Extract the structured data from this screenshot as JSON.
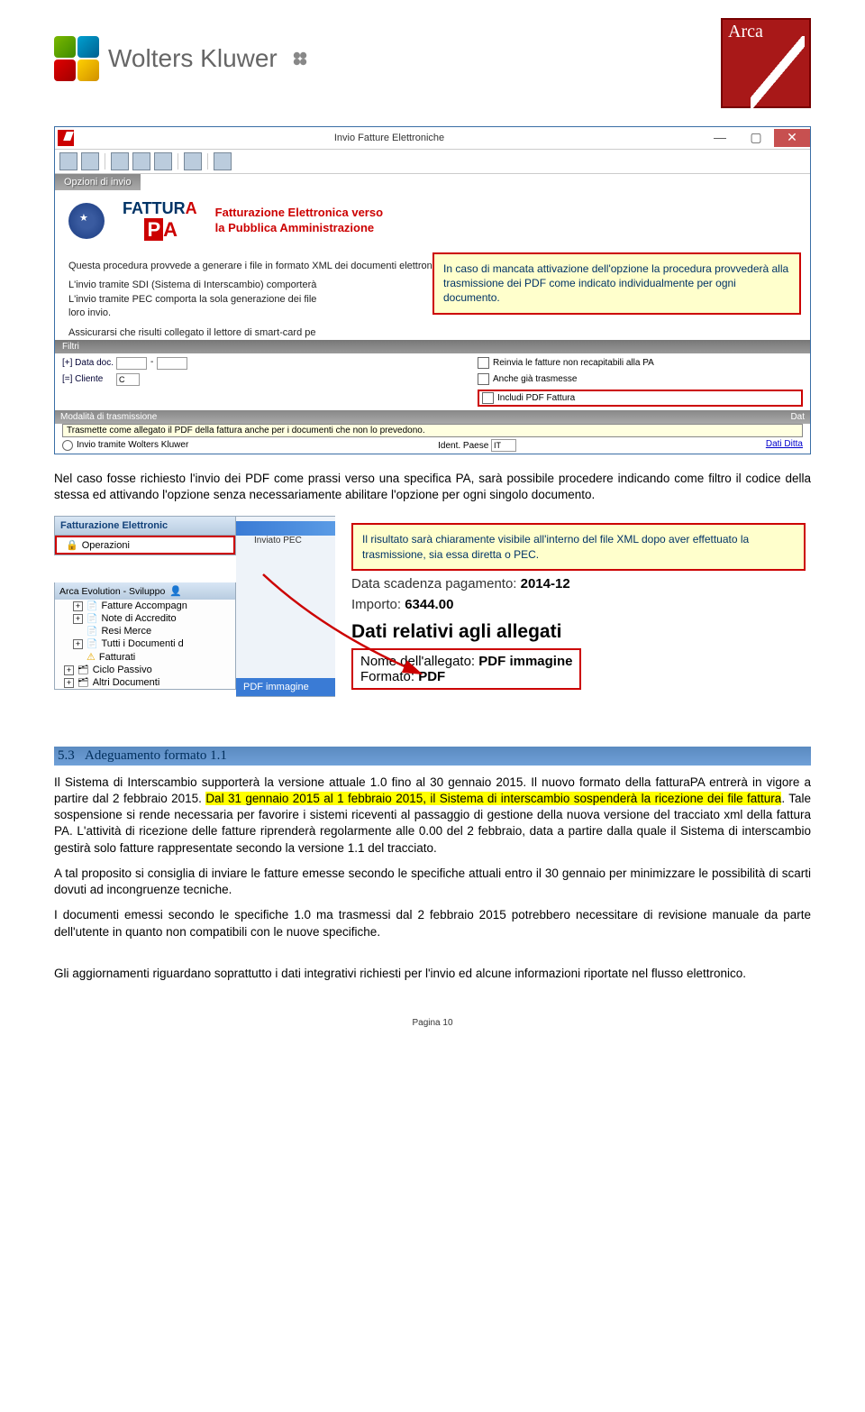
{
  "logos": {
    "wolters_kluwer": "Wolters Kluwer",
    "arca": "Arca"
  },
  "window1": {
    "title": "Invio Fatture Elettroniche",
    "tab": "Opzioni di invio",
    "heading1": "FATTUR",
    "heading_title_line1": "Fatturazione Elettronica verso",
    "heading_title_line2": "la Pubblica Amministrazione",
    "proc_line1": "Questa procedura provvede a generare i file in formato XML dei documenti elettronici.",
    "proc_line2": "L'invio tramite SDI (Sistema di Interscambio) comporterà",
    "proc_line3": "L'invio tramite PEC comporta la sola generazione dei file",
    "proc_line4": "loro invio.",
    "proc_line5": "Assicurarsi che risulti collegato il lettore di smart-card pe",
    "filter_tab": "Filtri",
    "filter_date_lbl": "[+] Data doc.",
    "filter_cli_lbl": "[=] Cliente",
    "filter_cli_val": "C",
    "chk1": "Reinvia le fatture non recapitabili alla PA",
    "chk2": "Anche già trasmesse",
    "chk3": "Includi PDF Fattura",
    "modal_lbl": "Modalità di trasmissione",
    "tooltip": "Trasmette come allegato il PDF della fattura anche per i documenti che non lo prevedono.",
    "ident_lbl": "Ident. Paese",
    "ident_val": "IT",
    "bottom_right": "Dati Ditta",
    "radio1": "Invio tramite Wolters Kluwer",
    "dat_lbl": "Dat"
  },
  "callout1": "In caso di mancata attivazione dell'opzione la procedura provvederà alla trasmissione dei PDF come indicato individualmente per ogni documento.",
  "para1": "Nel caso fosse richiesto l'invio dei PDF come prassi verso una specifica PA, sarà possibile procedere indicando come filtro il codice della stessa ed attivando l'opzione senza necessariamente abilitare l'opzione per ogni singolo documento.",
  "window2": {
    "panel_title": "Fatturazione Elettronic",
    "sel_item": "Operazioni",
    "inviato": "Inviato PEC",
    "sub_title": "Arca Evolution - Sviluppo",
    "items": [
      "Fatture Accompagn",
      "Note di Accredito",
      "Resi Merce",
      "Tutti i Documenti d",
      "Fatturati",
      "Ciclo Passivo",
      "Altri Documenti"
    ],
    "pdf_label": "PDF immagine"
  },
  "callout2": "Il risultato sarà chiaramente visibile all'interno del file XML dopo aver effettuato la trasmissione, sia essa diretta o PEC.",
  "details": {
    "scad_label": "Data scadenza pagamento: ",
    "scad_val": "2014-12",
    "imp_label": "Importo: ",
    "imp_val": "6344.00",
    "h3": "Dati relativi agli allegati",
    "nome_label": "Nome dell'allegato: ",
    "nome_val": "PDF immagine",
    "fmt_label": "Formato: ",
    "fmt_val": "PDF"
  },
  "section": {
    "num": "5.3",
    "title": "Adeguamento formato 1.1"
  },
  "p2_a": "Il Sistema di Interscambio supporterà la versione attuale 1.0 fino al 30 gennaio 2015. Il nuovo formato della fatturaPA entrerà in vigore a partire dal 2 febbraio 2015. ",
  "p2_hlt": "Dal 31 gennaio 2015 al 1 febbraio 2015, il Sistema di interscambio sospenderà la ricezione dei file fattura",
  "p2_b": ". Tale sospensione si rende necessaria per favorire i sistemi riceventi al passaggio di gestione della nuova versione del tracciato xml della fattura PA. L'attività di ricezione delle fatture riprenderà regolarmente alle 0.00 del 2 febbraio, data a partire dalla quale il Sistema di interscambio gestirà solo fatture rappresentate secondo la versione 1.1 del tracciato.",
  "p3": "A tal proposito si consiglia di inviare le fatture emesse secondo le specifiche attuali entro il 30 gennaio per minimizzare le possibilità di scarti dovuti ad incongruenze tecniche.",
  "p4": "I documenti emessi secondo le specifiche 1.0 ma trasmessi dal 2 febbraio 2015 potrebbero necessitare di revisione manuale da parte dell'utente in quanto non compatibili con le nuove specifiche.",
  "p5": "Gli aggiornamenti riguardano soprattutto i dati integrativi richiesti per l'invio ed alcune informazioni riportate nel flusso elettronico.",
  "page_no": "Pagina 10"
}
